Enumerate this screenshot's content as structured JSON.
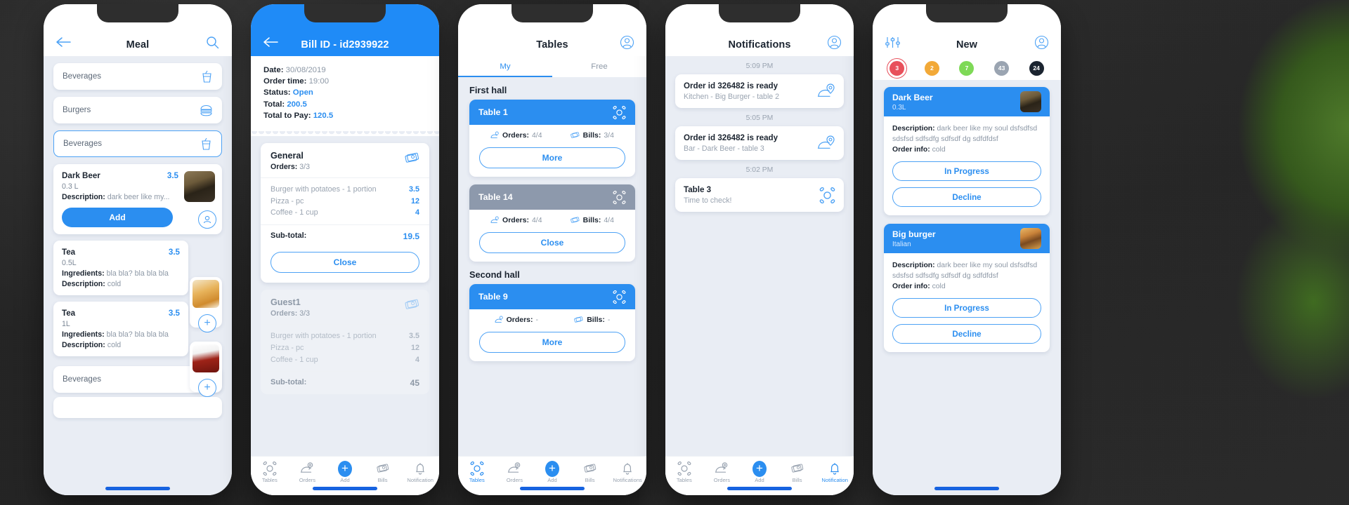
{
  "phone1": {
    "topbar": {
      "title": "Meal",
      "back_icon": "back-arrow-icon",
      "search_icon": "search-icon"
    },
    "categories": [
      {
        "label": "Beverages",
        "icon": "drink-cup-icon",
        "selected": false
      },
      {
        "label": "Burgers",
        "icon": "burger-icon",
        "selected": false
      },
      {
        "label": "Beverages",
        "icon": "drink-cup-icon",
        "selected": true
      }
    ],
    "footer_category": {
      "label": "Beverages",
      "icon": "drink-cup-icon"
    },
    "items": [
      {
        "name": "Dark Beer",
        "price": "3.5",
        "volume": "0.3 L",
        "desc_label": "Description:",
        "desc_value": "dark beer like my...",
        "action_label": "Add",
        "thumb": "dark-beer-photo"
      },
      {
        "name": "Tea",
        "price": "3.5",
        "volume": "0.5L",
        "ingredients_label": "Ingredients:",
        "ingredients_value": "bla bla? bla bla bla",
        "desc_label": "Description:",
        "desc_value": "cold",
        "thumb": "iced-tea-photo",
        "add_icon": "plus-circle-icon"
      },
      {
        "name": "Tea",
        "price": "3.5",
        "volume": "1L",
        "ingredients_label": "Ingredients:",
        "ingredients_value": "bla bla? bla bla bla",
        "desc_label": "Description:",
        "desc_value": "cold",
        "thumb": "tea-glass-photo",
        "add_icon": "plus-circle-icon"
      }
    ]
  },
  "phone2": {
    "topbar": {
      "title": "Bill ID - id2939922",
      "back_icon": "back-arrow-icon"
    },
    "info": [
      {
        "label": "Date:",
        "value": "30/08/2019",
        "accent": false
      },
      {
        "label": "Order time:",
        "value": "19:00",
        "accent": false
      },
      {
        "label": "Status:",
        "value": "Open",
        "accent": true
      },
      {
        "label": "Total:",
        "value": "200.5",
        "accent": true
      },
      {
        "label": "Total to Pay:",
        "value": "120.5",
        "accent": true
      }
    ],
    "bills": [
      {
        "title": "General",
        "orders_label": "Orders:",
        "orders_value": "3/3",
        "edit_icon": "bills-icon",
        "rows": [
          {
            "name": "Burger with potatoes - 1 portion",
            "value": "3.5"
          },
          {
            "name": "Pizza - pc",
            "value": "12"
          },
          {
            "name": "Coffee - 1 cup",
            "value": "4"
          }
        ],
        "subtotal_label": "Sub-total:",
        "subtotal_value": "19.5",
        "button_label": "Close",
        "muted": false
      },
      {
        "title": "Guest1",
        "orders_label": "Orders:",
        "orders_value": "3/3",
        "edit_icon": "bills-icon",
        "rows": [
          {
            "name": "Burger with potatoes - 1 portion",
            "value": "3.5"
          },
          {
            "name": "Pizza - pc",
            "value": "12"
          },
          {
            "name": "Coffee - 1 cup",
            "value": "4"
          }
        ],
        "subtotal_label": "Sub-total:",
        "subtotal_value": "45",
        "muted": true
      }
    ],
    "nav": [
      {
        "label": "Tables",
        "icon": "tables-icon",
        "active": false
      },
      {
        "label": "Orders",
        "icon": "orders-tray-icon",
        "active": false
      },
      {
        "label": "Add",
        "icon": "plus-fab-icon",
        "active": false
      },
      {
        "label": "Bills",
        "icon": "bills-icon",
        "active": false
      },
      {
        "label": "Notification",
        "icon": "bell-icon",
        "active": false
      }
    ]
  },
  "phone3": {
    "topbar": {
      "title": "Tables",
      "profile_icon": "user-avatar-icon"
    },
    "tabs": [
      {
        "label": "My",
        "active": true
      },
      {
        "label": "Free",
        "active": false
      }
    ],
    "halls": [
      {
        "name": "First hall",
        "tables": [
          {
            "title": "Table 1",
            "icon": "tables-icon",
            "state": "blue",
            "orders_label": "Orders:",
            "orders_value": "4/4",
            "bills_label": "Bills:",
            "bills_value": "3/4",
            "button_label": "More"
          },
          {
            "title": "Table 14",
            "icon": "tables-icon",
            "state": "grey",
            "orders_label": "Orders:",
            "orders_value": "4/4",
            "bills_label": "Bills:",
            "bills_value": "4/4",
            "button_label": "Close"
          }
        ]
      },
      {
        "name": "Second hall",
        "tables": [
          {
            "title": "Table 9",
            "icon": "tables-icon",
            "state": "blue",
            "orders_label": "Orders:",
            "orders_value": "-",
            "bills_label": "Bills:",
            "bills_value": "-",
            "button_label": "More"
          }
        ]
      }
    ],
    "nav": [
      {
        "label": "Tables",
        "icon": "tables-icon",
        "active": true
      },
      {
        "label": "Orders",
        "icon": "orders-tray-icon",
        "active": false
      },
      {
        "label": "Add",
        "icon": "plus-fab-icon",
        "active": false
      },
      {
        "label": "Bills",
        "icon": "bills-icon",
        "active": false
      },
      {
        "label": "Notifications",
        "icon": "bell-icon",
        "active": false
      }
    ]
  },
  "phone4": {
    "topbar": {
      "title": "Notifications",
      "profile_icon": "user-avatar-icon"
    },
    "notifications": [
      {
        "time": "5:09 PM",
        "title": "Order id 326482 is ready",
        "subtitle": "Kitchen - Big Burger - table 2",
        "icon": "order-ready-icon"
      },
      {
        "time": "5:05 PM",
        "title": "Order id 326482 is ready",
        "subtitle": "Bar - Dark Beer - table 3",
        "icon": "order-ready-icon"
      },
      {
        "time": "5:02 PM",
        "title": "Table 3",
        "subtitle": "Time to check!",
        "icon": "tables-icon"
      }
    ],
    "nav": [
      {
        "label": "Tables",
        "icon": "tables-icon",
        "active": false
      },
      {
        "label": "Orders",
        "icon": "orders-tray-icon",
        "active": false
      },
      {
        "label": "Add",
        "icon": "plus-fab-icon",
        "active": false
      },
      {
        "label": "Bills",
        "icon": "bills-icon",
        "active": false
      },
      {
        "label": "Notification",
        "icon": "bell-icon",
        "active": true
      }
    ]
  },
  "phone5": {
    "topbar": {
      "title": "New",
      "filter_icon": "sliders-filter-icon",
      "profile_icon": "user-avatar-icon"
    },
    "badges": [
      {
        "count": "3",
        "color": "#e8505b",
        "selected": true
      },
      {
        "count": "2",
        "color": "#f2a938",
        "selected": false
      },
      {
        "count": "7",
        "color": "#7ed957",
        "selected": false
      },
      {
        "count": "43",
        "color": "#9aa4b1",
        "selected": false
      },
      {
        "count": "24",
        "color": "#1b2430",
        "selected": false
      }
    ],
    "orders": [
      {
        "title": "Dark Beer",
        "subtitle": "0.3L",
        "thumb": "dark-beer-photo",
        "desc_label": "Description:",
        "desc_value": "dark beer like my soul dsfsdfsd sdsfsd sdfsdfg sdfsdf dg  sdfdfdsf",
        "info_label": "Order info:",
        "info_value": "cold",
        "primary_label": "In Progress",
        "secondary_label": "Decline"
      },
      {
        "title": "Big burger",
        "subtitle": "Italian",
        "thumb": "burger-photo",
        "desc_label": "Description:",
        "desc_value": "dark beer like my soul dsfsdfsd sdsfsd sdfsdfg sdfsdf dg  sdfdfdsf",
        "info_label": "Order info:",
        "info_value": "cold",
        "primary_label": "In Progress",
        "secondary_label": "Decline"
      }
    ]
  },
  "colors": {
    "accent_blue": "#2b8ef0",
    "header_blue": "#1f8bf7",
    "grey_state": "#8d99ac",
    "page_bg": "#e9edf4",
    "text_dark": "#1b2430",
    "text_muted": "#8d98a6"
  }
}
